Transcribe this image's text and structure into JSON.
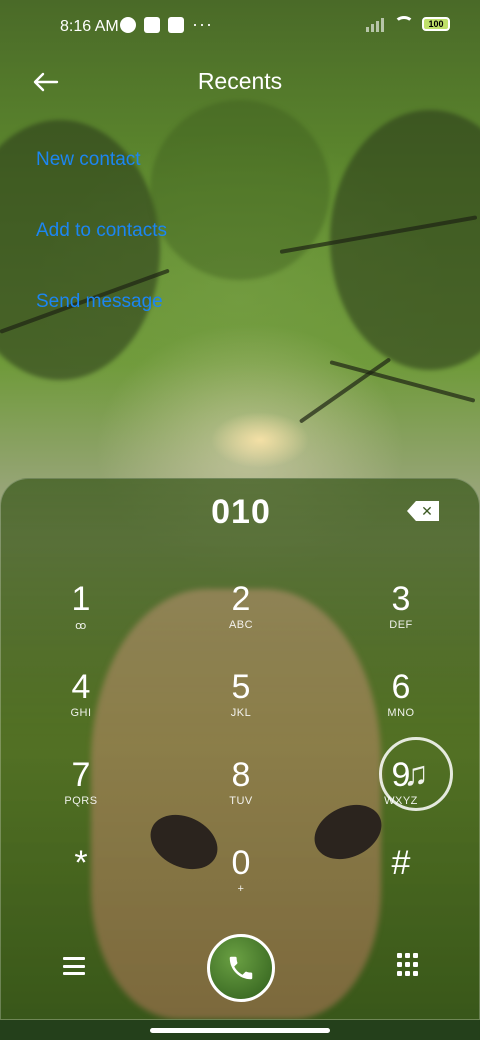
{
  "status_bar": {
    "time": "8:16 AM",
    "overflow": "···",
    "battery": "100"
  },
  "header": {
    "title": "Recents",
    "back_icon": "arrow-left-icon"
  },
  "actions": [
    {
      "label": "New contact"
    },
    {
      "label": "Add to contacts"
    },
    {
      "label": "Send message"
    }
  ],
  "colors": {
    "accent": "#1c86f2",
    "call_button": "#3a6b22"
  },
  "dialer": {
    "number": "010",
    "keys": [
      {
        "digit": "1",
        "letters": "ꝏ"
      },
      {
        "digit": "2",
        "letters": "ABC"
      },
      {
        "digit": "3",
        "letters": "DEF"
      },
      {
        "digit": "4",
        "letters": "GHI"
      },
      {
        "digit": "5",
        "letters": "JKL"
      },
      {
        "digit": "6",
        "letters": "MNO"
      },
      {
        "digit": "7",
        "letters": "PQRS"
      },
      {
        "digit": "8",
        "letters": "TUV"
      },
      {
        "digit": "9",
        "letters": "WXYZ"
      },
      {
        "digit": "*",
        "letters": ""
      },
      {
        "digit": "0",
        "letters": "+"
      },
      {
        "digit": "#",
        "letters": ""
      }
    ]
  }
}
